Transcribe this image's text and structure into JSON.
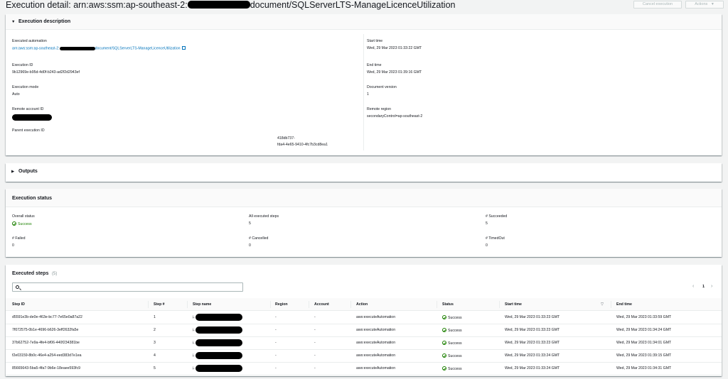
{
  "header": {
    "title_prefix": "Execution detail: arn:aws:ssm:ap-southeast-2:",
    "title_suffix": "document/SQLServerLTS-ManageLicenceUtilization",
    "cancel_label": "Cancel execution",
    "actions_label": "Actions"
  },
  "description": {
    "title": "Execution description",
    "executed_automation_label": "Executed automation",
    "executed_automation_prefix": "arn:aws:ssm:ap-southeast-2:",
    "executed_automation_suffix": "document/SQLServerLTS-ManageLicenceUtilization",
    "execution_id_label": "Execution ID",
    "execution_id": "9b12969e-b95d-4d0f-b243-ad2f2d2943ef",
    "execution_mode_label": "Execution mode",
    "execution_mode": "Auto",
    "remote_account_label": "Remote account ID",
    "parent_execution_label": "Parent execution ID",
    "parent_execution_line1": "418db737-",
    "parent_execution_line2": "fda4-4e65-9410-4fc7b3cd8ea1",
    "start_time_label": "Start time",
    "start_time": "Wed, 29 Mar 2023 01:33:22 GMT",
    "end_time_label": "End time",
    "end_time": "Wed, 29 Mar 2023 01:39:16 GMT",
    "document_version_label": "Document version",
    "document_version": "1",
    "remote_region_label": "Remote region",
    "remote_region": "secondaryControl=ap-southeast-2"
  },
  "outputs": {
    "title": "Outputs"
  },
  "status": {
    "title": "Execution status",
    "overall_label": "Overall status",
    "overall_value": "Success",
    "all_steps_label": "All executed steps",
    "all_steps_value": "5",
    "succeeded_label": "# Succeeded",
    "succeeded_value": "5",
    "failed_label": "# Failed",
    "failed_value": "0",
    "cancelled_label": "# Cancelled",
    "cancelled_value": "0",
    "timedout_label": "# TimedOut",
    "timedout_value": "0"
  },
  "steps": {
    "title": "Executed steps",
    "count": "(5)",
    "page": "1",
    "columns": [
      "Step ID",
      "Step #",
      "Step name",
      "Region",
      "Account",
      "Action",
      "Status",
      "Start time",
      "End time"
    ],
    "rows": [
      {
        "id": "d5591e3b-de0e-463e-bc77-7e65e0a87a22",
        "num": "1",
        "name_prefix": "i-",
        "region": "-",
        "account": "-",
        "action": "aws:executeAutomation",
        "status": "Success",
        "start": "Wed, 29 Mar 2023 01:33:23 GMT",
        "end": "Wed, 29 Mar 2023 01:33:59 GMT"
      },
      {
        "id": "7f072575-0b1e-4696-b626-3eff2632fa5e",
        "num": "2",
        "name_prefix": "i-",
        "region": "-",
        "account": "-",
        "action": "aws:executeAutomation",
        "status": "Success",
        "start": "Wed, 29 Mar 2023 01:33:23 GMT",
        "end": "Wed, 29 Mar 2023 01:34:24 GMT"
      },
      {
        "id": "37b62752-7e9a-4fe4-bf06-440f234381be",
        "num": "3",
        "name_prefix": "i-",
        "region": "-",
        "account": "-",
        "action": "aws:executeAutomation",
        "status": "Success",
        "start": "Wed, 29 Mar 2023 01:33:23 GMT",
        "end": "Wed, 29 Mar 2023 01:34:01 GMT"
      },
      {
        "id": "f2e03159-8b0c-46e4-a254-eed383d7e1ea",
        "num": "4",
        "name_prefix": "i-",
        "region": "-",
        "account": "-",
        "action": "aws:executeAutomation",
        "status": "Success",
        "start": "Wed, 29 Mar 2023 01:33:24 GMT",
        "end": "Wed, 29 Mar 2023 01:39:15 GMT"
      },
      {
        "id": "85665643-5ba5-4fa7-9b6e-18eaee593fc9",
        "num": "5",
        "name_prefix": "i-",
        "region": "-",
        "account": "-",
        "action": "aws:executeAutomation",
        "status": "Success",
        "start": "Wed, 29 Mar 2023 01:33:24 GMT",
        "end": "Wed, 29 Mar 2023 01:34:31 GMT"
      }
    ]
  }
}
